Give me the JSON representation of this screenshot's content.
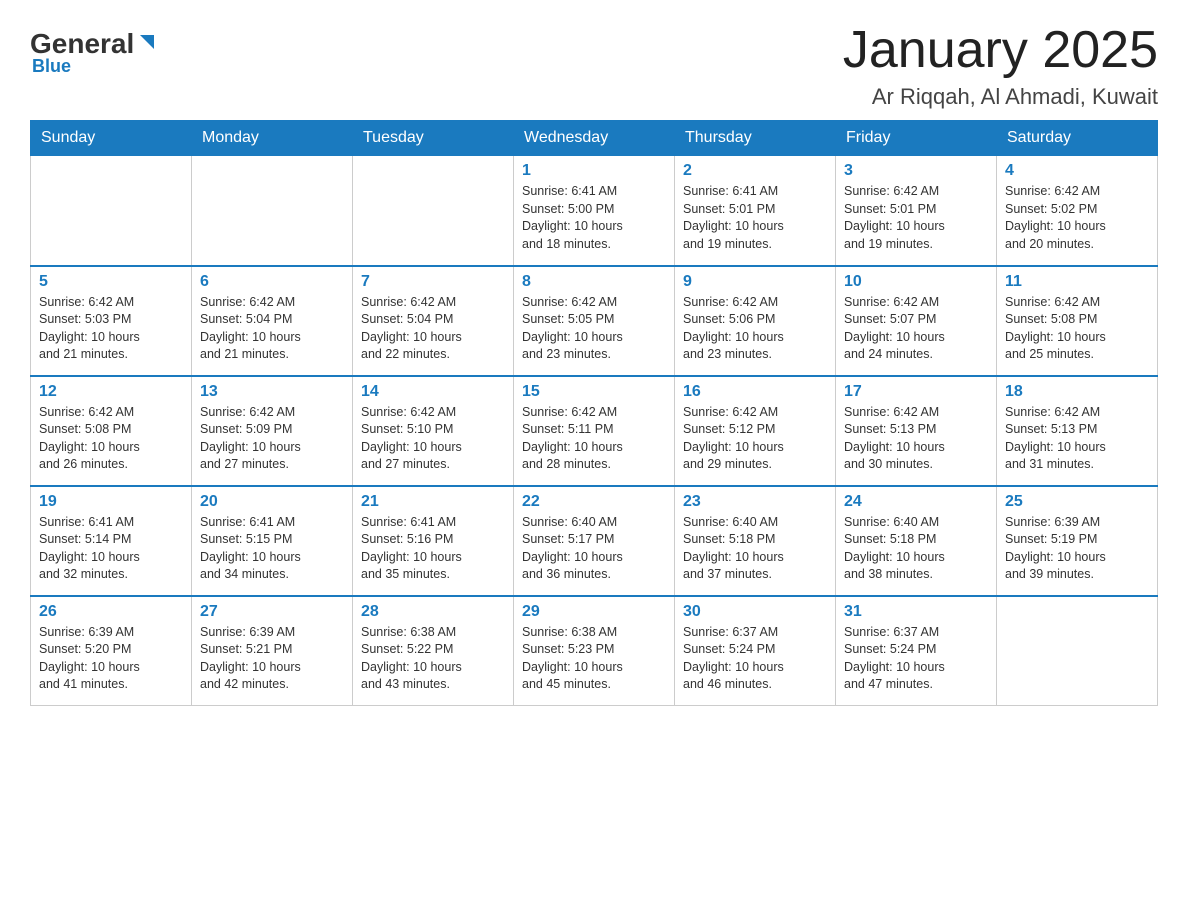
{
  "header": {
    "logo_main": "General",
    "logo_sub": "Blue",
    "title": "January 2025",
    "subtitle": "Ar Riqqah, Al Ahmadi, Kuwait"
  },
  "days_of_week": [
    "Sunday",
    "Monday",
    "Tuesday",
    "Wednesday",
    "Thursday",
    "Friday",
    "Saturday"
  ],
  "weeks": [
    [
      {
        "day": "",
        "info": ""
      },
      {
        "day": "",
        "info": ""
      },
      {
        "day": "",
        "info": ""
      },
      {
        "day": "1",
        "info": "Sunrise: 6:41 AM\nSunset: 5:00 PM\nDaylight: 10 hours\nand 18 minutes."
      },
      {
        "day": "2",
        "info": "Sunrise: 6:41 AM\nSunset: 5:01 PM\nDaylight: 10 hours\nand 19 minutes."
      },
      {
        "day": "3",
        "info": "Sunrise: 6:42 AM\nSunset: 5:01 PM\nDaylight: 10 hours\nand 19 minutes."
      },
      {
        "day": "4",
        "info": "Sunrise: 6:42 AM\nSunset: 5:02 PM\nDaylight: 10 hours\nand 20 minutes."
      }
    ],
    [
      {
        "day": "5",
        "info": "Sunrise: 6:42 AM\nSunset: 5:03 PM\nDaylight: 10 hours\nand 21 minutes."
      },
      {
        "day": "6",
        "info": "Sunrise: 6:42 AM\nSunset: 5:04 PM\nDaylight: 10 hours\nand 21 minutes."
      },
      {
        "day": "7",
        "info": "Sunrise: 6:42 AM\nSunset: 5:04 PM\nDaylight: 10 hours\nand 22 minutes."
      },
      {
        "day": "8",
        "info": "Sunrise: 6:42 AM\nSunset: 5:05 PM\nDaylight: 10 hours\nand 23 minutes."
      },
      {
        "day": "9",
        "info": "Sunrise: 6:42 AM\nSunset: 5:06 PM\nDaylight: 10 hours\nand 23 minutes."
      },
      {
        "day": "10",
        "info": "Sunrise: 6:42 AM\nSunset: 5:07 PM\nDaylight: 10 hours\nand 24 minutes."
      },
      {
        "day": "11",
        "info": "Sunrise: 6:42 AM\nSunset: 5:08 PM\nDaylight: 10 hours\nand 25 minutes."
      }
    ],
    [
      {
        "day": "12",
        "info": "Sunrise: 6:42 AM\nSunset: 5:08 PM\nDaylight: 10 hours\nand 26 minutes."
      },
      {
        "day": "13",
        "info": "Sunrise: 6:42 AM\nSunset: 5:09 PM\nDaylight: 10 hours\nand 27 minutes."
      },
      {
        "day": "14",
        "info": "Sunrise: 6:42 AM\nSunset: 5:10 PM\nDaylight: 10 hours\nand 27 minutes."
      },
      {
        "day": "15",
        "info": "Sunrise: 6:42 AM\nSunset: 5:11 PM\nDaylight: 10 hours\nand 28 minutes."
      },
      {
        "day": "16",
        "info": "Sunrise: 6:42 AM\nSunset: 5:12 PM\nDaylight: 10 hours\nand 29 minutes."
      },
      {
        "day": "17",
        "info": "Sunrise: 6:42 AM\nSunset: 5:13 PM\nDaylight: 10 hours\nand 30 minutes."
      },
      {
        "day": "18",
        "info": "Sunrise: 6:42 AM\nSunset: 5:13 PM\nDaylight: 10 hours\nand 31 minutes."
      }
    ],
    [
      {
        "day": "19",
        "info": "Sunrise: 6:41 AM\nSunset: 5:14 PM\nDaylight: 10 hours\nand 32 minutes."
      },
      {
        "day": "20",
        "info": "Sunrise: 6:41 AM\nSunset: 5:15 PM\nDaylight: 10 hours\nand 34 minutes."
      },
      {
        "day": "21",
        "info": "Sunrise: 6:41 AM\nSunset: 5:16 PM\nDaylight: 10 hours\nand 35 minutes."
      },
      {
        "day": "22",
        "info": "Sunrise: 6:40 AM\nSunset: 5:17 PM\nDaylight: 10 hours\nand 36 minutes."
      },
      {
        "day": "23",
        "info": "Sunrise: 6:40 AM\nSunset: 5:18 PM\nDaylight: 10 hours\nand 37 minutes."
      },
      {
        "day": "24",
        "info": "Sunrise: 6:40 AM\nSunset: 5:18 PM\nDaylight: 10 hours\nand 38 minutes."
      },
      {
        "day": "25",
        "info": "Sunrise: 6:39 AM\nSunset: 5:19 PM\nDaylight: 10 hours\nand 39 minutes."
      }
    ],
    [
      {
        "day": "26",
        "info": "Sunrise: 6:39 AM\nSunset: 5:20 PM\nDaylight: 10 hours\nand 41 minutes."
      },
      {
        "day": "27",
        "info": "Sunrise: 6:39 AM\nSunset: 5:21 PM\nDaylight: 10 hours\nand 42 minutes."
      },
      {
        "day": "28",
        "info": "Sunrise: 6:38 AM\nSunset: 5:22 PM\nDaylight: 10 hours\nand 43 minutes."
      },
      {
        "day": "29",
        "info": "Sunrise: 6:38 AM\nSunset: 5:23 PM\nDaylight: 10 hours\nand 45 minutes."
      },
      {
        "day": "30",
        "info": "Sunrise: 6:37 AM\nSunset: 5:24 PM\nDaylight: 10 hours\nand 46 minutes."
      },
      {
        "day": "31",
        "info": "Sunrise: 6:37 AM\nSunset: 5:24 PM\nDaylight: 10 hours\nand 47 minutes."
      },
      {
        "day": "",
        "info": ""
      }
    ]
  ]
}
